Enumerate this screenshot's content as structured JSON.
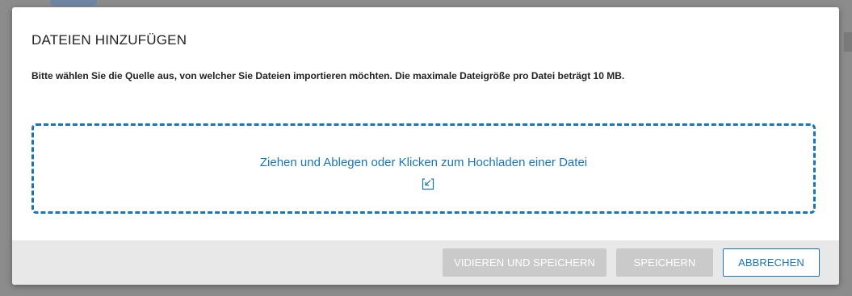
{
  "dialog": {
    "title": "DATEIEN HINZUFÜGEN",
    "description": "Bitte wählen Sie die Quelle aus, von welcher Sie Dateien importieren möchten. Die maximale Dateigröße pro Datei beträgt 10 MB.",
    "dropzone": {
      "text": "Ziehen und Ablegen oder Klicken zum Hochladen einer Datei",
      "icon": "upload-icon"
    },
    "footer": {
      "validate_save_label": "VIDIEREN UND SPEICHERN",
      "save_label": "SPEICHERN",
      "cancel_label": "ABBRECHEN"
    }
  },
  "colors": {
    "accent": "#1a75b5",
    "disabled_button": "#cacaca",
    "footer_background": "#e8e8e8",
    "overlay": "#8c8c8c"
  }
}
